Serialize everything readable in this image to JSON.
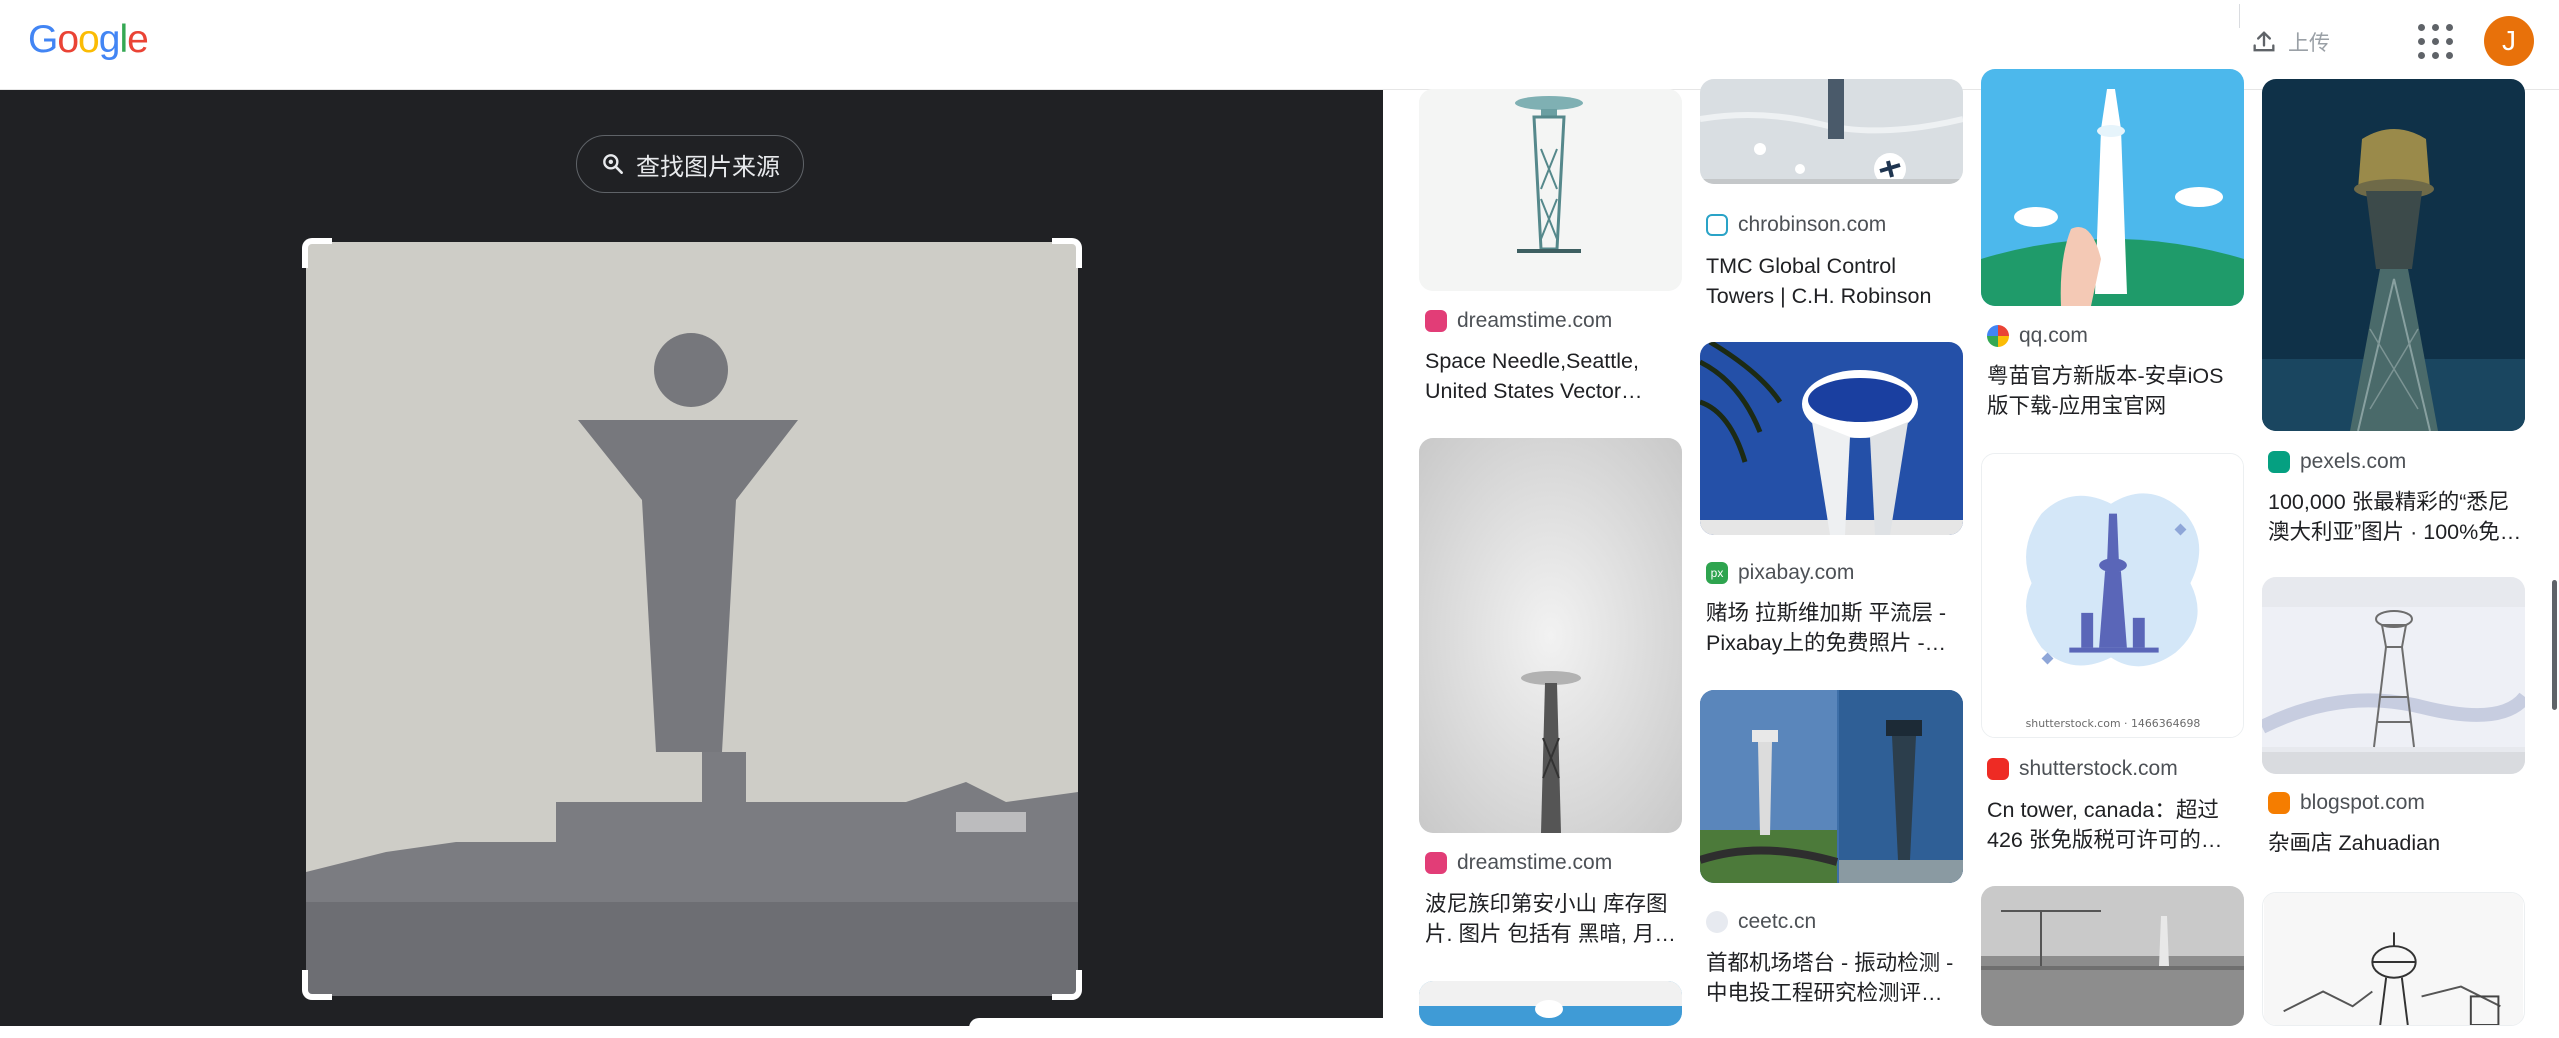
{
  "header": {
    "logo_letters": [
      "G",
      "o",
      "o",
      "g",
      "l",
      "e"
    ],
    "logo_colors": [
      "#4285F4",
      "#EA4335",
      "#FBBC05",
      "#4285F4",
      "#34A853",
      "#EA4335"
    ],
    "upload_label": "上传",
    "avatar_initial": "J",
    "avatar_color": "#e8710a"
  },
  "lens": {
    "find_source_label": "查找图片来源"
  },
  "results": [
    {
      "site": "dreamstime.com",
      "title": "Space Needle,Seattle, United States Vector…"
    },
    {
      "site": "dreamstime.com",
      "title": "波尼族印第安小山 库存图片. 图片 包括有 黑暗, 月…"
    },
    {
      "site": "chrobinson.com",
      "title": "TMC Global Control Towers | C.H. Robinson"
    },
    {
      "site": "pixabay.com",
      "title": "赌场 拉斯维加斯 平流层 - Pixabay上的免费照片 -…"
    },
    {
      "site": "ceetc.cn",
      "title": "首都机场塔台 - 振动检测 - 中电投工程研究检测评…"
    },
    {
      "site": "qq.com",
      "title": "粤苗官方新版本-安卓iOS版下载-应用宝官网"
    },
    {
      "site": "shutterstock.com",
      "title": "Cn tower, canada：超过 426 张免版税可许可的库…"
    },
    {
      "site": "pexels.com",
      "title": "100,000 张最精彩的“悉尼澳大利亚”图片 · 100%免…"
    },
    {
      "site": "blogspot.com",
      "title": "杂画店 Zahuadian"
    }
  ],
  "watermarks": {
    "shutterstock_id": "shutterstock.com · 1466364698"
  }
}
